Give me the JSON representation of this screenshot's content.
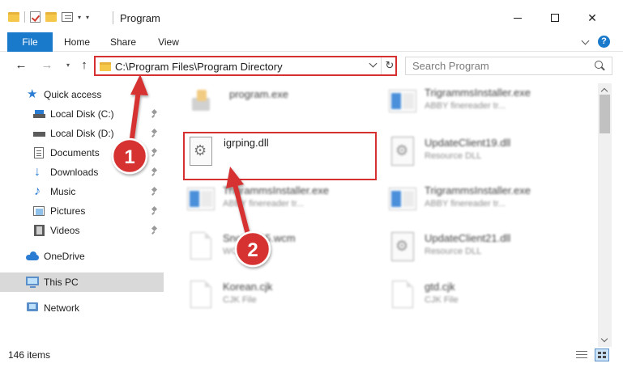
{
  "window": {
    "title": "Program",
    "controls": {
      "minimize": "minimize",
      "maximize": "maximize",
      "close": "✕"
    }
  },
  "ribbon": {
    "tabs": [
      {
        "label": "File",
        "active": true
      },
      {
        "label": "Home"
      },
      {
        "label": "Share"
      },
      {
        "label": "View"
      }
    ],
    "help": "?"
  },
  "nav": {
    "back": "←",
    "forward": "→",
    "recent": "▾",
    "up": "↑",
    "address": "C:\\Program Files\\Program Directory",
    "refresh": "↻",
    "search_placeholder": "Search Program"
  },
  "sidebar": {
    "items": [
      {
        "label": "Quick access",
        "icon": "star-icon",
        "pinned": false
      },
      {
        "label": "Local Disk (C:)",
        "icon": "disk-icon",
        "pinned": true
      },
      {
        "label": "Local Disk (D:)",
        "icon": "disk-icon",
        "pinned": true
      },
      {
        "label": "Documents",
        "icon": "documents-icon",
        "pinned": true
      },
      {
        "label": "Downloads",
        "icon": "downloads-icon",
        "pinned": true
      },
      {
        "label": "Music",
        "icon": "music-icon",
        "pinned": true
      },
      {
        "label": "Pictures",
        "icon": "pictures-icon",
        "pinned": true
      },
      {
        "label": "Videos",
        "icon": "videos-icon",
        "pinned": true
      },
      {
        "label": "OneDrive",
        "icon": "onedrive-icon",
        "pinned": false
      },
      {
        "label": "This PC",
        "icon": "pc-icon",
        "pinned": false,
        "selected": true
      },
      {
        "label": "Network",
        "icon": "network-icon",
        "pinned": false
      }
    ]
  },
  "files": [
    {
      "name": "program.exe",
      "sub": "",
      "icon": "exe-icon",
      "blurred": true
    },
    {
      "name": "TrigrammsInstaller.exe",
      "sub": "ABBY finereader tr...",
      "icon": "installer-icon",
      "blurred": true
    },
    {
      "name": "igrping.dll",
      "sub": "",
      "icon": "dll-gear-icon",
      "blurred": false
    },
    {
      "name": "UpdateClient19.dll",
      "sub": "Resource DLL",
      "icon": "dll-gear-icon",
      "blurred": true
    },
    {
      "name": "TrigrammsInstaller.exe",
      "sub": "ABBY finereader tr...",
      "icon": "installer-icon",
      "blurred": true
    },
    {
      "name": "TrigrammsInstaller.exe",
      "sub": "ABBY finereader tr...",
      "icon": "installer-icon",
      "blurred": true
    },
    {
      "name": "Snob2015.wcm",
      "sub": "WCM File",
      "icon": "blank-file-icon",
      "blurred": true
    },
    {
      "name": "UpdateClient21.dll",
      "sub": "Resource DLL",
      "icon": "dll-gear-icon",
      "blurred": true
    },
    {
      "name": "Korean.cjk",
      "sub": "CJK File",
      "icon": "blank-file-icon",
      "blurred": true
    },
    {
      "name": "gtd.cjk",
      "sub": "CJK File",
      "icon": "blank-file-icon",
      "blurred": true
    }
  ],
  "status": {
    "items_count": "146 items"
  },
  "annotations": [
    {
      "number": "1",
      "color": "#d63031"
    },
    {
      "number": "2",
      "color": "#d63031"
    }
  ],
  "colors": {
    "accent": "#1979ca",
    "highlight": "#d63031",
    "selected": "#d9d9d9"
  }
}
